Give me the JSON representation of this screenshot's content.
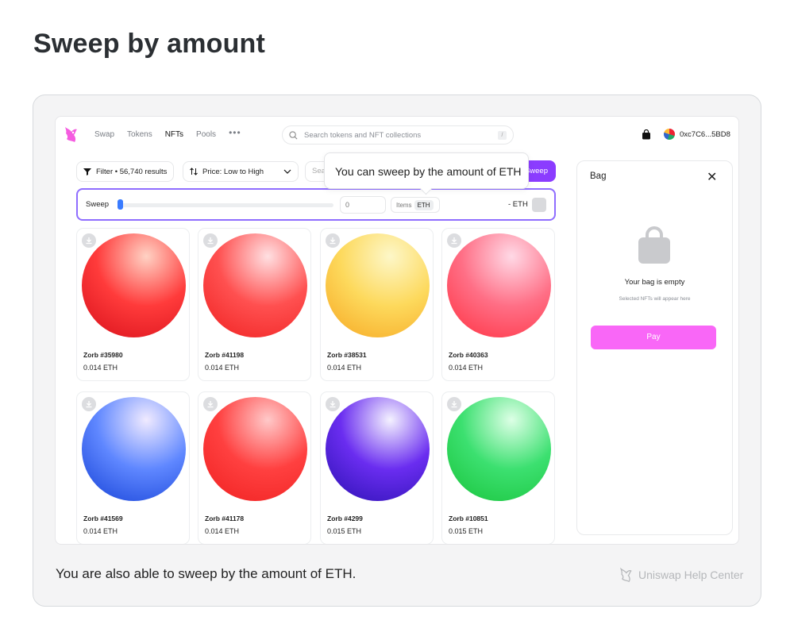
{
  "page": {
    "title": "Sweep by amount",
    "caption": "You are also able to sweep by the amount of ETH.",
    "brand": "Uniswap Help Center"
  },
  "nav": {
    "links": [
      "Swap",
      "Tokens",
      "NFTs",
      "Pools"
    ],
    "active": "NFTs",
    "more": "•••",
    "search_placeholder": "Search tokens and NFT collections",
    "search_shortcut": "/",
    "wallet_address": "0xc7C6...5BD8"
  },
  "toolbar": {
    "filter_label": "Filter • 56,740 results",
    "sort_label": "Price: Low to High",
    "search_partial": "Sea",
    "sweep_button": "Sweep"
  },
  "tooltip": {
    "text": "You can sweep by the amount of ETH"
  },
  "sweep": {
    "label": "Sweep",
    "value": "0",
    "unit_items": "Items",
    "unit_eth": "ETH",
    "total": "- ETH",
    "slider_level": 0
  },
  "colors": {
    "accent": "#8b3cff",
    "pay": "#f967f7",
    "slider": "#3a7bff"
  },
  "cards": [
    {
      "name": "Zorb #35980",
      "price": "0.014 ETH",
      "color_light": "#ffd2c4",
      "color_main": "#ff3b3b",
      "color_dark": "#d70f1a"
    },
    {
      "name": "Zorb #41198",
      "price": "0.014 ETH",
      "color_light": "#ffe0e2",
      "color_main": "#ff5050",
      "color_dark": "#ef2020"
    },
    {
      "name": "Zorb #38531",
      "price": "0.014 ETH",
      "color_light": "#fdf7c8",
      "color_main": "#fdd95c",
      "color_dark": "#f6a621"
    },
    {
      "name": "Zorb #40363",
      "price": "0.014 ETH",
      "color_light": "#ffd9e6",
      "color_main": "#ff6f86",
      "color_dark": "#ff2f3f"
    },
    {
      "name": "Zorb #41569",
      "price": "0.014 ETH",
      "color_light": "#f0eaff",
      "color_main": "#5f87ff",
      "color_dark": "#1440d6"
    },
    {
      "name": "Zorb #41178",
      "price": "0.014 ETH",
      "color_light": "#ffc9c9",
      "color_main": "#ff4040",
      "color_dark": "#ef2020"
    },
    {
      "name": "Zorb #4299",
      "price": "0.015 ETH",
      "color_light": "#f4f2ff",
      "color_main": "#6a2df0",
      "color_dark": "#2a10b0"
    },
    {
      "name": "Zorb #10851",
      "price": "0.015 ETH",
      "color_light": "#ddffe6",
      "color_main": "#3ce070",
      "color_dark": "#18c33a"
    }
  ],
  "bag": {
    "title": "Bag",
    "empty_title": "Your bag is empty",
    "empty_subtitle": "Selected NFTs will appear here",
    "pay_label": "Pay"
  }
}
